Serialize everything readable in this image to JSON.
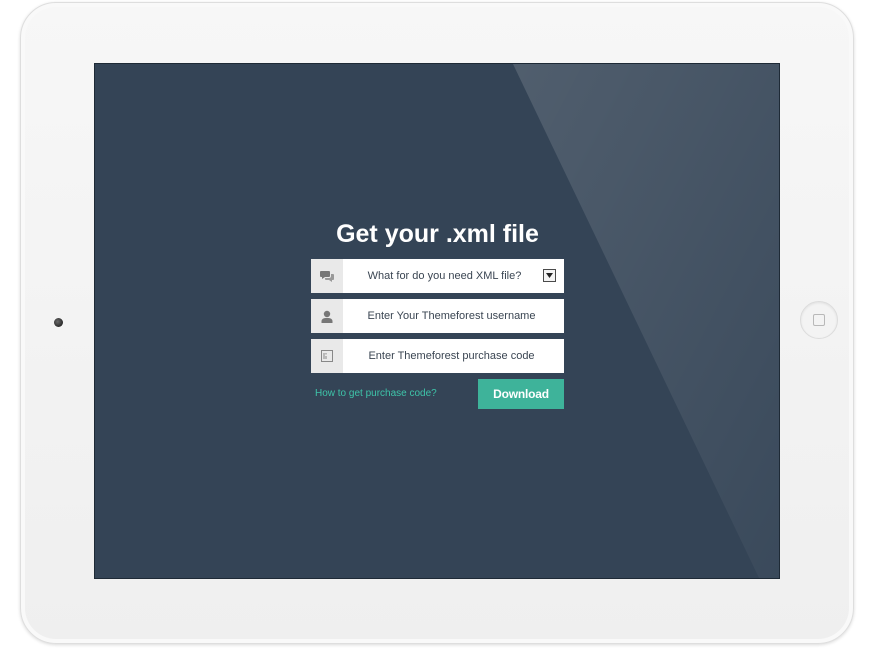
{
  "form": {
    "title": "Get your .xml file",
    "fields": [
      {
        "type": "select",
        "icon": "chat-bubbles-icon",
        "value": "What for do you need XML file?"
      },
      {
        "type": "text",
        "icon": "user-icon",
        "placeholder": "Enter Your Themeforest username"
      },
      {
        "type": "text",
        "icon": "barcode-icon",
        "placeholder": "Enter Themeforest purchase code"
      }
    ],
    "help_link": "How to get purchase code?",
    "submit_label": "Download"
  },
  "colors": {
    "screen_bg": "#344456",
    "accent": "#3eb39a",
    "link": "#3ec4a9",
    "title": "#ffffff"
  }
}
